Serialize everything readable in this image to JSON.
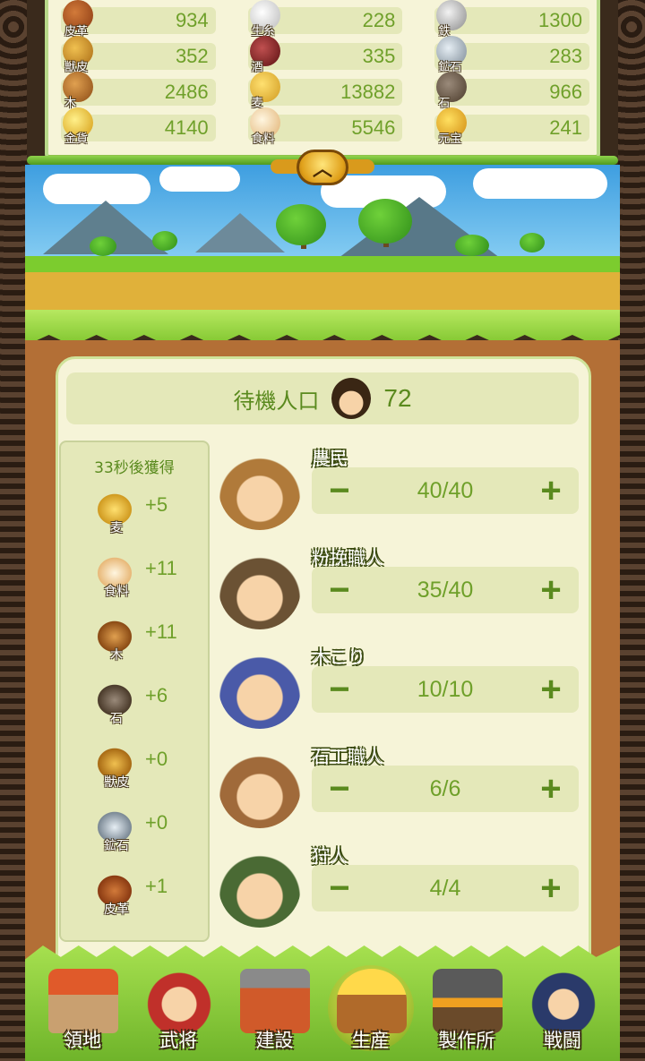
{
  "resources": [
    {
      "name": "皮革",
      "value": "934",
      "icon": "leather-icon"
    },
    {
      "name": "生糸",
      "value": "228",
      "icon": "silk-icon"
    },
    {
      "name": "鉄",
      "value": "1300",
      "icon": "iron-icon"
    },
    {
      "name": "獣皮",
      "value": "352",
      "icon": "hide-icon"
    },
    {
      "name": "酒",
      "value": "335",
      "icon": "sake-icon"
    },
    {
      "name": "鉱石",
      "value": "283",
      "icon": "ore-icon"
    },
    {
      "name": "木",
      "value": "2486",
      "icon": "wood-icon"
    },
    {
      "name": "麦",
      "value": "13882",
      "icon": "wheat-icon"
    },
    {
      "name": "石",
      "value": "966",
      "icon": "stone-icon"
    },
    {
      "name": "金貨",
      "value": "4140",
      "icon": "gold-coin-icon"
    },
    {
      "name": "食料",
      "value": "5546",
      "icon": "food-icon"
    },
    {
      "name": "元宝",
      "value": "241",
      "icon": "ingot-icon"
    }
  ],
  "colors": {
    "panel_bg": "#f6f4d8",
    "field_bg": "#e4e8b9",
    "accent_green": "#6fa02a",
    "board_brown": "#b36f36"
  },
  "idle": {
    "label": "待機人口",
    "value": "72"
  },
  "gain": {
    "title": "33秒後獲得",
    "items": [
      {
        "name": "麦",
        "value": "+5",
        "icon": "wheat-icon"
      },
      {
        "name": "食料",
        "value": "+11",
        "icon": "food-icon"
      },
      {
        "name": "木",
        "value": "+11",
        "icon": "wood-icon"
      },
      {
        "name": "石",
        "value": "+6",
        "icon": "stone-icon"
      },
      {
        "name": "獣皮",
        "value": "+0",
        "icon": "hide-icon"
      },
      {
        "name": "鉱石",
        "value": "+0",
        "icon": "ore-icon"
      },
      {
        "name": "皮革",
        "value": "+1",
        "icon": "leather-icon"
      }
    ]
  },
  "jobs": [
    {
      "name": "農民",
      "count": "40/40",
      "minus": "−",
      "plus": "+"
    },
    {
      "name": "粉挽職人",
      "count": "35/40",
      "minus": "−",
      "plus": "+"
    },
    {
      "name": "木こり",
      "count": "10/10",
      "minus": "−",
      "plus": "+"
    },
    {
      "name": "石工職人",
      "count": "6/6",
      "minus": "−",
      "plus": "+"
    },
    {
      "name": "狩人",
      "count": "4/4",
      "minus": "−",
      "plus": "+"
    }
  ],
  "nav": [
    {
      "label": "領地",
      "icon": "territory-icon"
    },
    {
      "label": "武将",
      "icon": "general-icon"
    },
    {
      "label": "建設",
      "icon": "build-icon"
    },
    {
      "label": "生産",
      "icon": "production-icon",
      "active": true
    },
    {
      "label": "製作所",
      "icon": "workshop-icon"
    },
    {
      "label": "戦闘",
      "icon": "battle-icon"
    }
  ]
}
